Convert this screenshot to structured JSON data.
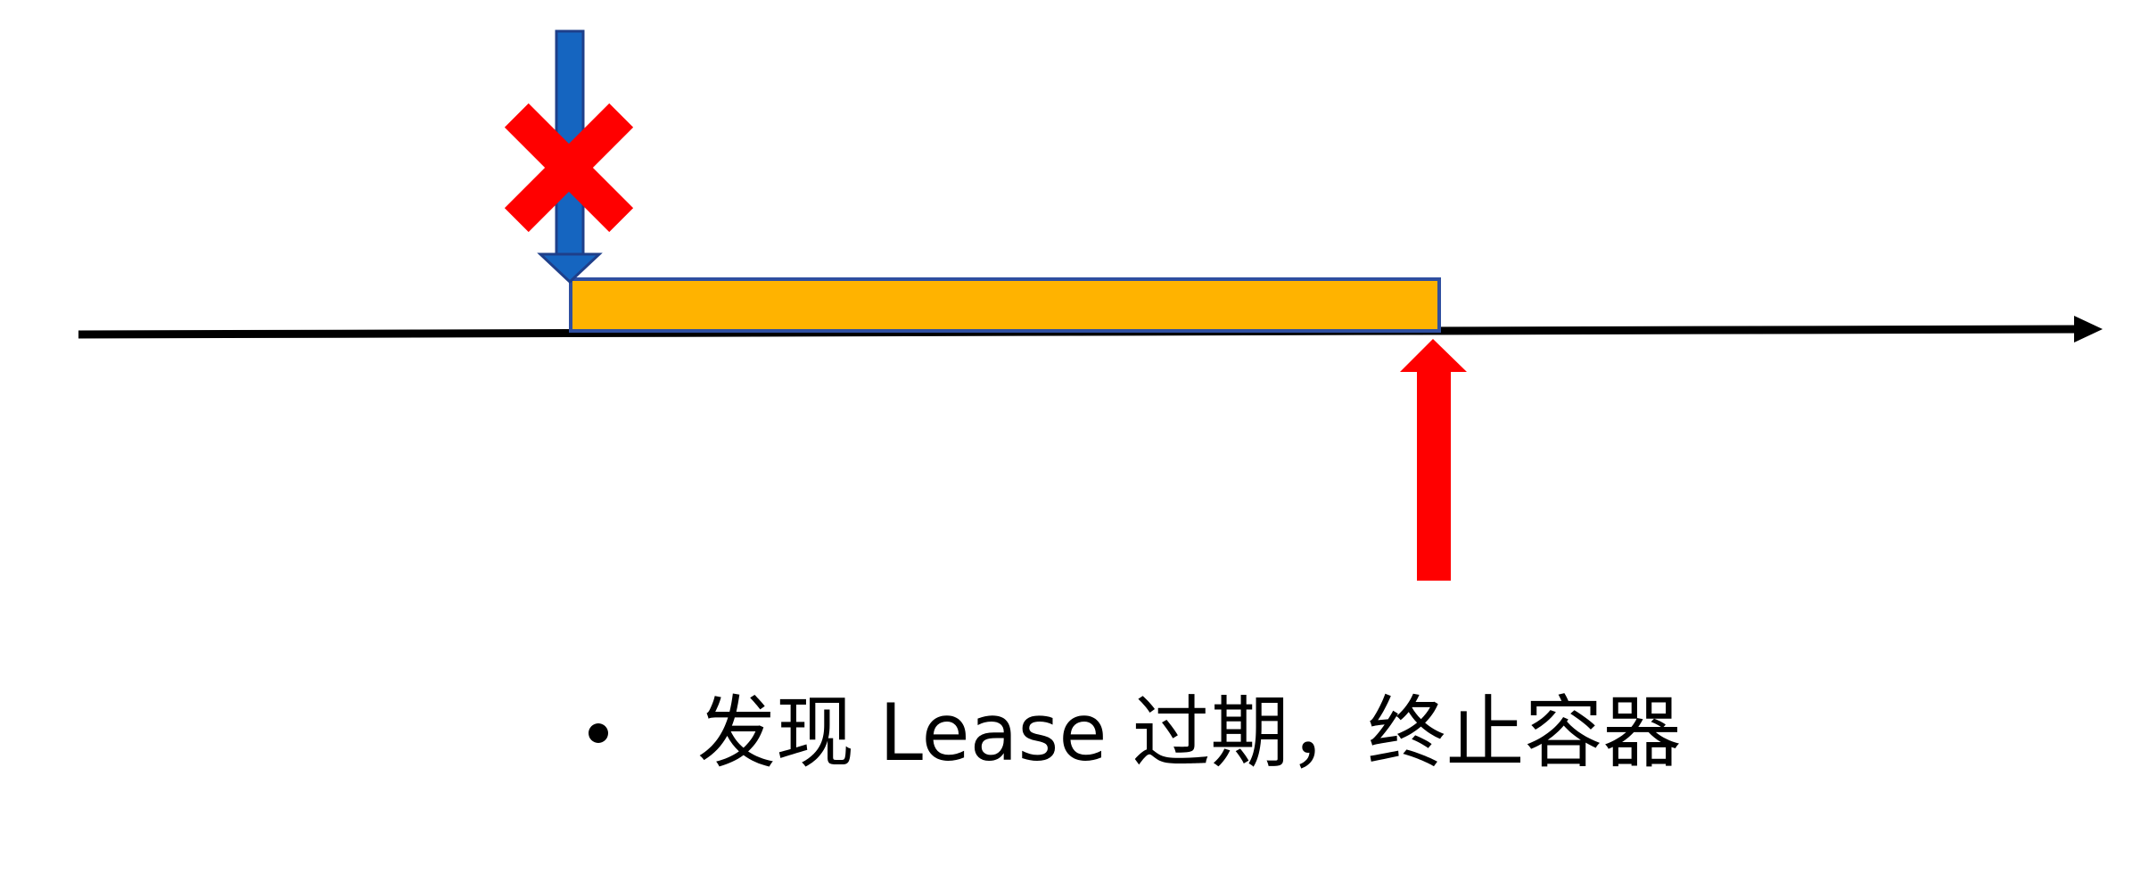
{
  "caption": {
    "text": "发现 Lease 过期，终止容器"
  },
  "colors": {
    "timeline": "#000000",
    "lease_bar_fill": "#FFB300",
    "lease_bar_border": "#2F4FA0",
    "blue_arrow": "#1565C0",
    "blue_arrow_border": "#1E3F8A",
    "red_arrow": "#FF0000",
    "cross_mark": "#FF0000"
  },
  "icons": {
    "cross": "x-icon",
    "down_arrow": "down-arrow-icon",
    "up_arrow": "up-arrow-icon"
  }
}
